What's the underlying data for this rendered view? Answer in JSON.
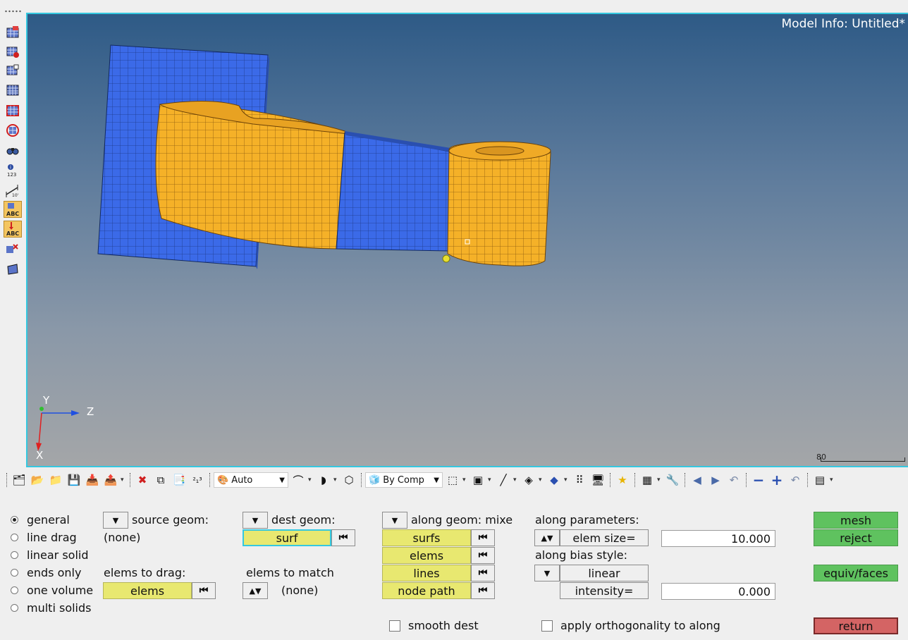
{
  "viewport": {
    "model_info": "Model Info: Untitled*",
    "triad": {
      "y": "Y",
      "z": "Z",
      "x": "X"
    },
    "scale_value": "80"
  },
  "toolbar": {
    "vis_mode": "Auto",
    "color_mode": "By Comp"
  },
  "panel": {
    "modes": [
      {
        "label": "general",
        "selected": true
      },
      {
        "label": "line drag",
        "selected": false
      },
      {
        "label": "linear solid",
        "selected": false
      },
      {
        "label": "ends only",
        "selected": false
      },
      {
        "label": "one volume",
        "selected": false
      },
      {
        "label": "multi solids",
        "selected": false
      }
    ],
    "source_geom_label": "source geom:",
    "source_geom_value": "(none)",
    "elems_to_drag_label": "elems to drag:",
    "elems_button": "elems",
    "dest_geom_label": "dest geom:",
    "surf_button": "surf",
    "elems_to_match_label": "elems to match",
    "elems_to_match_value": "(none)",
    "along_geom_label": "along geom: mixe",
    "along_buttons": [
      "surfs",
      "elems",
      "lines",
      "node path"
    ],
    "along_params_label": "along parameters:",
    "elem_size_label": "elem size=",
    "elem_size_value": "10.000",
    "bias_style_label": "along bias style:",
    "bias_style_value": "linear",
    "intensity_label": "intensity=",
    "intensity_value": "0.000",
    "smooth_dest": "smooth dest",
    "apply_orthogonality": "apply orthogonality to along",
    "mesh_button": "mesh",
    "reject_button": "reject",
    "equiv_button": "equiv/faces",
    "return_button": "return"
  }
}
